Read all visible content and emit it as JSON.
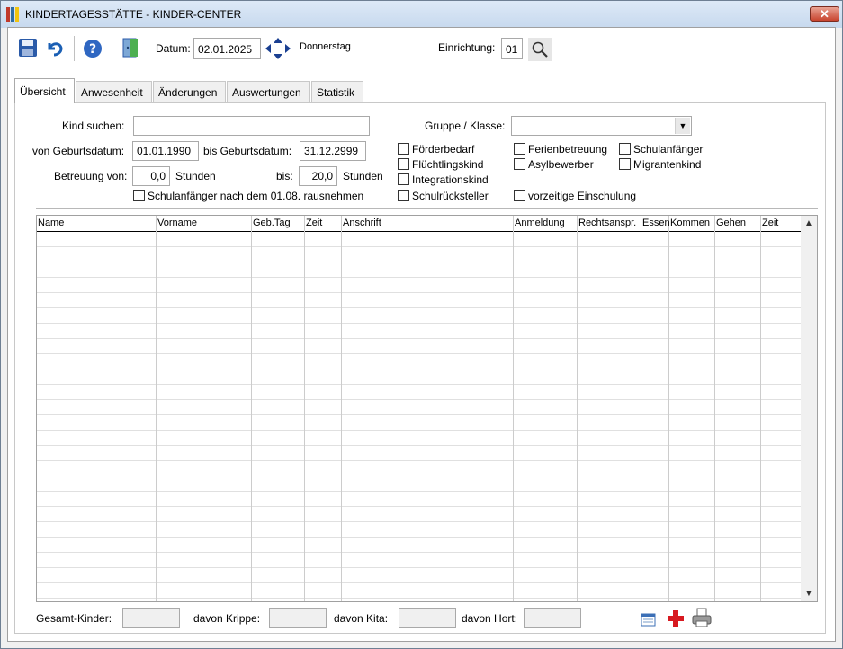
{
  "window": {
    "title": "KINDERTAGESSTÄTTE - KINDER-CENTER",
    "close_label": "✕"
  },
  "toolbar": {
    "datum_label": "Datum:",
    "datum_value": "02.01.2025",
    "weekday": "Donnerstag",
    "einrichtung_label": "Einrichtung:",
    "einrichtung_value": "01"
  },
  "tabs": [
    "Übersicht",
    "Anwesenheit",
    "Änderungen",
    "Auswertungen",
    "Statistik"
  ],
  "filters": {
    "kind_suchen_label": "Kind suchen:",
    "kind_suchen_value": "",
    "gruppe_label": "Gruppe / Klasse:",
    "gruppe_value": "",
    "von_geb_label": "von Geburtsdatum:",
    "von_geb_value": "01.01.1990",
    "bis_geb_label": "bis Geburtsdatum:",
    "bis_geb_value": "31.12.2999",
    "betreuung_label": "Betreuung von:",
    "betreuung_von_value": "0,0",
    "stunden_label_1": "Stunden",
    "bis_label": "bis:",
    "betreuung_bis_value": "20,0",
    "stunden_label_2": "Stunden",
    "schulanfaenger_nach_label": "Schulanfänger nach dem 01.08. rausnehmen",
    "checkboxes": {
      "foerderbedarf": "Förderbedarf",
      "ferienbetreuung": "Ferienbetreuung",
      "schulanfaenger": "Schulanfänger",
      "fluechtlingskind": "Flüchtlingskind",
      "asylbewerber": "Asylbewerber",
      "migrantenkind": "Migrantenkind",
      "integrationskind": "Integrationskind",
      "schulrueckstellter": "Schulrücksteller",
      "vorzeitige": "vorzeitige Einschulung"
    }
  },
  "grid": {
    "columns": [
      "Name",
      "Vorname",
      "Geb.Tag",
      "Zeit",
      "Anschrift",
      "Anmeldung",
      "Rechtsanspr.",
      "Essen",
      "Kommen",
      "Gehen",
      "Zeit"
    ],
    "rows": []
  },
  "footer": {
    "gesamt_label": "Gesamt-Kinder:",
    "gesamt_value": "",
    "krippe_label": "davon Krippe:",
    "krippe_value": "",
    "kita_label": "davon Kita:",
    "kita_value": "",
    "hort_label": "davon Hort:",
    "hort_value": ""
  }
}
